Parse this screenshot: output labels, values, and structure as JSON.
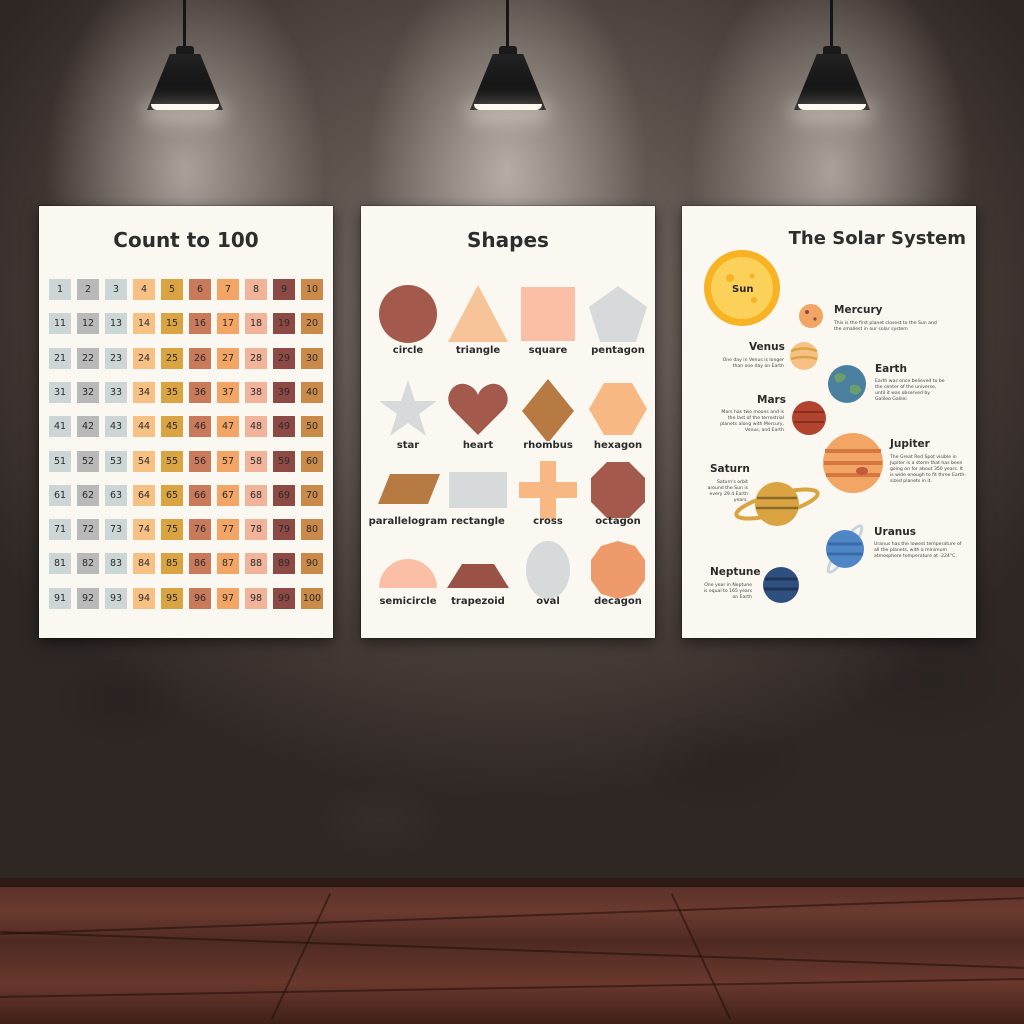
{
  "posters": {
    "count": {
      "title": "Count to 100",
      "numbers": [
        "1",
        "2",
        "3",
        "4",
        "5",
        "6",
        "7",
        "8",
        "9",
        "10",
        "11",
        "12",
        "13",
        "14",
        "15",
        "16",
        "17",
        "18",
        "19",
        "20",
        "21",
        "22",
        "23",
        "24",
        "25",
        "26",
        "27",
        "28",
        "29",
        "30",
        "31",
        "32",
        "33",
        "34",
        "35",
        "36",
        "37",
        "38",
        "39",
        "40",
        "41",
        "42",
        "43",
        "44",
        "45",
        "46",
        "47",
        "48",
        "49",
        "50",
        "51",
        "52",
        "53",
        "54",
        "55",
        "56",
        "57",
        "58",
        "59",
        "60",
        "61",
        "62",
        "63",
        "64",
        "65",
        "66",
        "67",
        "68",
        "69",
        "70",
        "71",
        "72",
        "73",
        "74",
        "75",
        "76",
        "77",
        "78",
        "79",
        "80",
        "81",
        "82",
        "83",
        "84",
        "85",
        "86",
        "87",
        "88",
        "89",
        "90",
        "91",
        "92",
        "93",
        "94",
        "95",
        "96",
        "97",
        "98",
        "99",
        "100"
      ],
      "column_colors": [
        "#cdd6d6",
        "#b9b9b9",
        "#cdd6d6",
        "#f7c084",
        "#d9a441",
        "#c97a5b",
        "#f2a564",
        "#f2b39b",
        "#8d4a44",
        "#c98a4a"
      ]
    },
    "shapes": {
      "title": "Shapes",
      "items": [
        {
          "label": "circle",
          "color": "#a35a4c"
        },
        {
          "label": "triangle",
          "color": "#f7c49a"
        },
        {
          "label": "square",
          "color": "#fbbfa5"
        },
        {
          "label": "pentagon",
          "color": "#d6dada"
        },
        {
          "label": "star",
          "color": "#d6dada"
        },
        {
          "label": "heart",
          "color": "#a35a4c"
        },
        {
          "label": "rhombus",
          "color": "#b87a43"
        },
        {
          "label": "hexagon",
          "color": "#f7b884"
        },
        {
          "label": "parallelogram",
          "color": "#b87a43"
        },
        {
          "label": "rectangle",
          "color": "#d6dada"
        },
        {
          "label": "cross",
          "color": "#f7b884"
        },
        {
          "label": "octagon",
          "color": "#a35a4c"
        },
        {
          "label": "semicircle",
          "color": "#fbbfa5"
        },
        {
          "label": "trapezoid",
          "color": "#9a5246"
        },
        {
          "label": "oval",
          "color": "#d6dada"
        },
        {
          "label": "decagon",
          "color": "#ef9a6a"
        }
      ]
    },
    "solar": {
      "title": "The Solar System",
      "sun": "Sun",
      "planets": {
        "mercury": {
          "name": "Mercury",
          "text": "This is the first planet closest to the Sun and the smallest in our solar system"
        },
        "venus": {
          "name": "Venus",
          "text": "One day in Venus is longer than one day on Earth"
        },
        "earth": {
          "name": "Earth",
          "text": "Earth was once believed to be the center of the universe, until it was observed by Galileo Galilei"
        },
        "mars": {
          "name": "Mars",
          "text": "Mars has two moons and is the last of the terrestrial planets along with Mercury, Venus, and Earth"
        },
        "jupiter": {
          "name": "Jupiter",
          "text": "The Great Red Spot visible in Jupiter is a storm that has been going on for about 350 years. It is wide enough to fit three Earth-sized planets in it."
        },
        "saturn": {
          "name": "Saturn",
          "text": "Saturn's orbit around the Sun is every 29.4 Earth years."
        },
        "uranus": {
          "name": "Uranus",
          "text": "Uranus has the lowest temperature of all the planets, with a minimum atmosphere temperature at -224°C."
        },
        "neptune": {
          "name": "Neptune",
          "text": "One year in Neptune is equal to 165 years on Earth"
        }
      }
    }
  }
}
